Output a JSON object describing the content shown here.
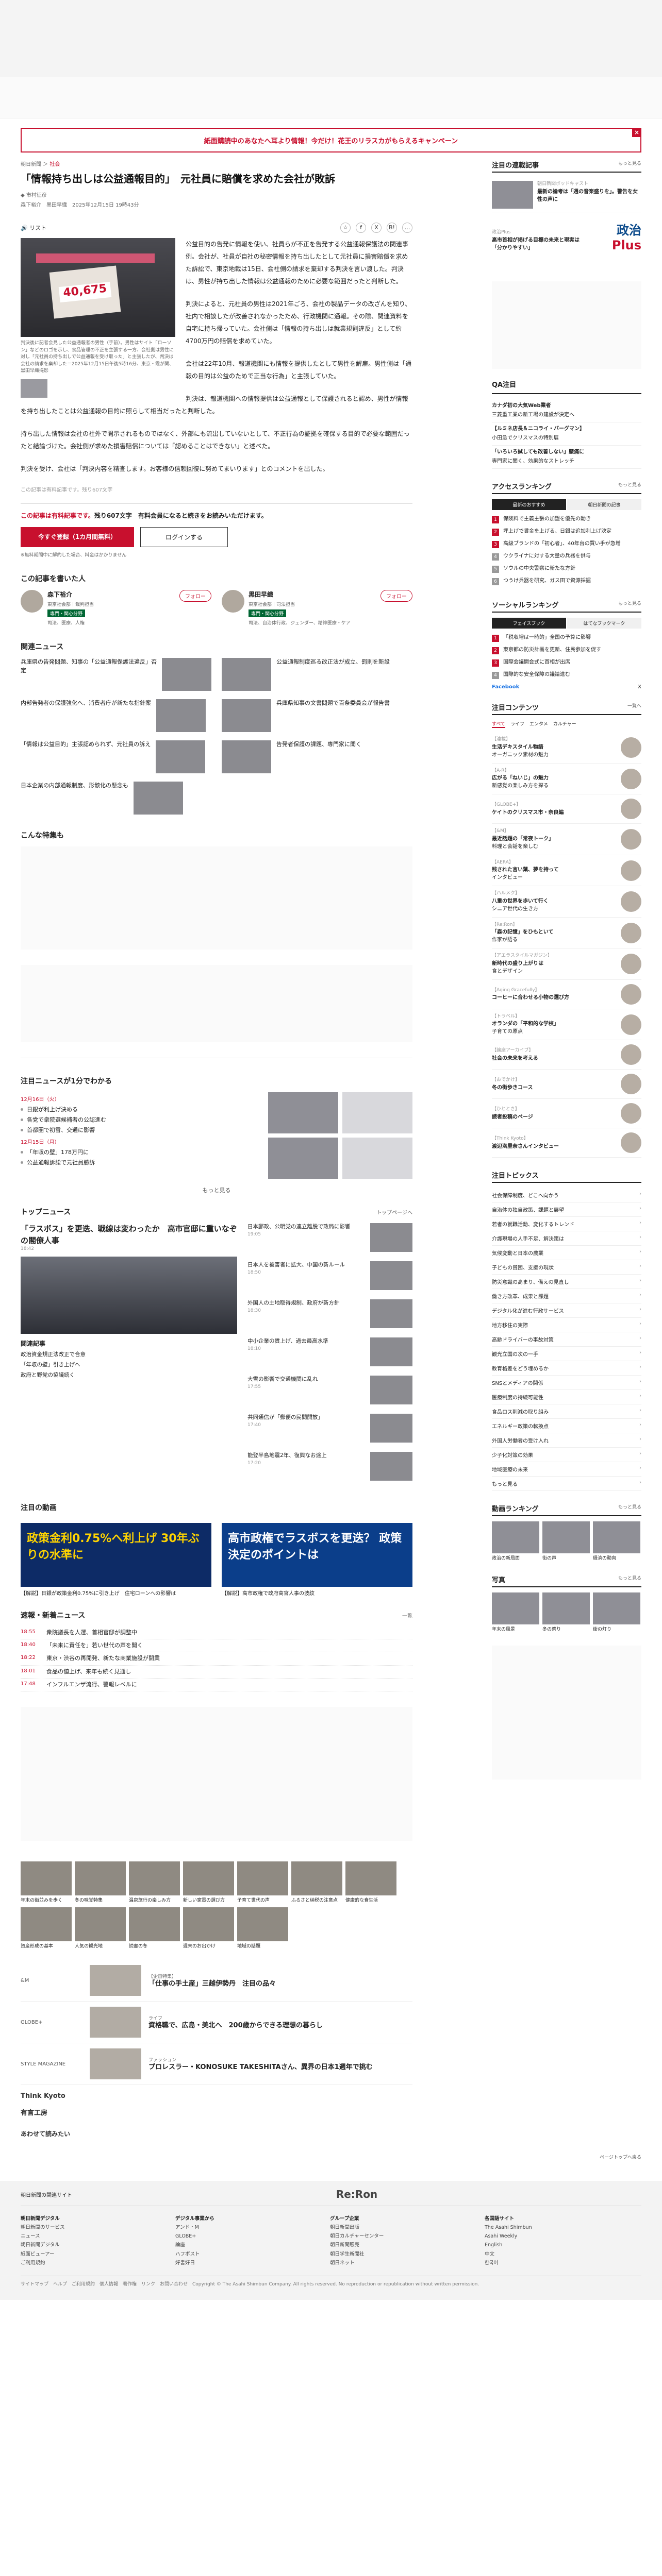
{
  "banner": {
    "text": "紙面購読中のあなたへ耳より情報！今だけ！花王のリラスカがもらえるキャンペーン",
    "close": "×"
  },
  "article": {
    "crumb_section": "朝日新聞",
    "crumb_badge": "社会",
    "title": "「情報持ち出しは公益通報目的」　元社員に賠償を求めた会社が敗訴",
    "author": "市村征彦",
    "meta": "森下裕介　黒田早織　2025年12月15日 19時43分",
    "listen": "リスト",
    "photo_number": "40,675",
    "caption": "判決後に記者会見した公益通報者の男性（手前）。男性はサイト「ローソン」などのロゴを示し、食品管理の不正を主張する一方、会社側は男性に対し「元社員の持ち出しで公益通報を受け取った」と主張したが、判決は会社の請求を棄却した＝2025年12月15日午後5時16分、東京・霞が関、黒田早織撮影",
    "thumb_caption": "写真",
    "paragraphs": [
      "公益目的の告発に情報を使い、社員らが不正を告発する公益通報保護法の関連事例。会社が、社員が自社の秘密情報を持ち出したとして元社員に損害賠償を求めた訴訟で、東京地裁は15日、会社側の請求を棄却する判決を言い渡した。判決は、男性が持ち出した情報は公益通報のために必要な範囲だったと判断した。",
      "判決によると、元社員の男性は2021年ごろ、会社の製品データの改ざんを知り、社内で相談したが改善されなかったため、行政機関に通報。その際、関連資料を自宅に持ち帰っていた。会社側は「情報の持ち出しは就業規則違反」として約4700万円の賠償を求めていた。",
      "会社は22年10月、報道機関にも情報を提供したとして男性を解雇。男性側は「通報の目的は公益のためで正当な行為」と主張していた。",
      "判決は、報道機関への情報提供は公益通報として保護されると認め、男性が情報を持ち出したことは公益通報の目的に照らして相当だったと判断した。",
      "持ち出した情報は会社の社外で開示されるものではなく、外部にも流出していないとして、不正行為の証拠を確保する目的で必要な範囲だったと結論づけた。会社側が求めた損害賠償については「認めることはできない」と述べた。",
      "判決を受け、会社は「判決内容を精査します。お客様の信頼回復に努めてまいります」とのコメントを出した。"
    ],
    "footnote": "この記事は有料記事です。残り607文字",
    "pay_lead": "この記事は有料記事です。",
    "pay_rest": "残り607文字　有料会員になると続きをお読みいただけます。",
    "btn_trial": "今すぐ登録（1カ月間無料）",
    "btn_login": "ログインする",
    "pay_note": "※無料期間中に解約した場合、料金はかかりません",
    "share_label": "シェア"
  },
  "writers": {
    "title": "この記事を書いた人",
    "list": [
      {
        "name": "森下裕介",
        "dept": "東京社会部｜裁判担当",
        "tag": "専門・関心分野",
        "topics": "司法、医療、人権",
        "follow": "フォロー"
      },
      {
        "name": "黒田早織",
        "dept": "東京社会部｜司法担当",
        "tag": "専門・関心分野",
        "topics": "司法、自治体行政、ジェンダー、精神医療・ケア",
        "follow": "フォロー"
      }
    ]
  },
  "related": {
    "title": "関連ニュース",
    "items": [
      {
        "title": "兵庫県の告発問題、知事の「公益通報保護法違反」否定",
        "date": ""
      },
      {
        "title": "公益通報制度巡る改正法が成立、罰則を新設",
        "date": ""
      },
      {
        "title": "内部告発者の保護強化へ、消費者庁が新たな指針案",
        "date": ""
      },
      {
        "title": "兵庫県知事の文書問題で百条委員会が報告書",
        "date": ""
      },
      {
        "title": "「情報は公益目的」主張認められず、元社員の訴え",
        "date": ""
      },
      {
        "title": "告発者保護の課題、専門家に聞く",
        "date": ""
      },
      {
        "title": "日本企業の内部通報制度、形骸化の懸念も",
        "date": ""
      }
    ]
  },
  "empty_section": "こんな特集も",
  "ranking": {
    "title": "注目ニュースが1分でわかる",
    "date1": "12月16日（火）",
    "items1": [
      "日銀が利上げ決める",
      "各党で衆院選候補者の公認進む",
      "首都圏で初雪、交通に影響"
    ],
    "date2": "12月15日（月）",
    "items2": [
      "「年収の壁」178万円に",
      "公益通報訴訟で元社員勝訴"
    ],
    "more": "もっと見る"
  },
  "topnews": {
    "title": "トップニュース",
    "more": "トップページへ",
    "big": "「ラスボス」を更迭、戦線は変わったか　高市官邸に重いなぞの閣僚人事",
    "big_date": "18:42",
    "rows": [
      {
        "title": "日本郵政、公明党の連立離脱で政局に影響",
        "date": "19:05"
      },
      {
        "title": "日本人を被害者に拡大、中国の新ルール",
        "date": "18:50"
      },
      {
        "title": "外国人の土地取得規制、政府が新方針",
        "date": "18:30"
      },
      {
        "title": "中小企業の賃上げ、過去最高水準",
        "date": "18:10"
      },
      {
        "title": "大雪の影響で交通機関に乱れ",
        "date": "17:55"
      },
      {
        "title": "共同通信が「郵便の民間開放」",
        "date": "17:40"
      },
      {
        "title": "能登半島地震2年、復興なお途上",
        "date": "17:20"
      }
    ],
    "rel_title": "関連記事",
    "rel": [
      "政治資金規正法改正で合意",
      "「年収の壁」引き上げへ",
      "政府と野党の協議続く"
    ]
  },
  "highlights": {
    "title": "注目の動画",
    "cards": [
      {
        "img": "政策金利0.75%へ利上げ 30年ぶりの水準に",
        "text": "【解説】日銀が政策金利0.75%に引き上げ　住宅ローンへの影響は"
      },
      {
        "img": "高市政権でラスボスを更迭？ 政策決定のポイントは",
        "text": "【解説】高市政権で政府高官人事の波紋"
      }
    ]
  },
  "latest": {
    "title": "速報・新着ニュース",
    "more": "一覧",
    "items": [
      {
        "tag": "18:55",
        "title": "衆院議長を人選、首相官邸が調整中"
      },
      {
        "tag": "18:40",
        "title": "「未来に責任を」若い世代の声を聞く"
      },
      {
        "tag": "18:22",
        "title": "東京・渋谷の再開発、新たな商業施設が開業"
      },
      {
        "tag": "18:01",
        "title": "食品の値上げ、来年も続く見通し"
      },
      {
        "tag": "17:48",
        "title": "インフルエンザ流行、警報レベルに"
      }
    ]
  },
  "promos": [
    "年末の街並みを歩く",
    "冬の味覚特集",
    "温泉旅行の楽しみ方",
    "新しい家電の選び方",
    "子育て世代の声",
    "ふるさと納税の注意点",
    "健康的な食生活",
    "資産形成の基本",
    "人気の観光地",
    "読書の冬",
    "週末のお出かけ",
    "地域の話題"
  ],
  "partners": [
    {
      "logo": "&M",
      "kicker": "【企画特集】",
      "head": "「仕事の手土産」三越伊勢丹　注目の品々"
    },
    {
      "logo": "GLOBE+",
      "kicker": "ライフ",
      "head": "資格職で、広島・美北へ　200歳からできる理想の暮らし"
    },
    {
      "logo": "STYLE MAGAZINE",
      "kicker": "ファッション",
      "head": "プロレスラー・KONOSUKE TAKESHITAさん、異界の日本1週年で挑む"
    }
  ],
  "brands": [
    "Think Kyoto",
    "有言工房",
    "あわせて読みたい"
  ],
  "side": {
    "video_title": "注目の連載記事",
    "video_more": "もっと見る",
    "feature": [
      {
        "kicker": "朝日新聞ポッドキャスト",
        "head": "最新の論考は「週の音楽盛りを」。警告を女性の声に",
        "img": ""
      },
      {
        "kicker": "政治Plus",
        "head": "高市首相が掲げる目標の未来と現実は「分かりやすい」"
      }
    ],
    "plus_logo": "政治",
    "plus_sub": "Plus",
    "qa_title": "QA注目",
    "qa": [
      {
        "head": "カナダ初の大気Web業者",
        "sub": "三菱重工業の新工場の建設が決定へ"
      },
      {
        "head": "【ルミネ店長＆ニコライ・バーグマン】",
        "sub": "小田急でクリスマスの特別展"
      },
      {
        "head": "「いろいろ試しても改善しない」腰痛に",
        "sub": "専門家に聞く、効果的なストレッチ"
      }
    ],
    "access_title": "アクセスランキング",
    "access_more": "もっと見る",
    "access_tabs": [
      "最新のおすすめ",
      "朝日新聞の記事"
    ],
    "access": [
      "保険料で主義主張の加盟を優先の動き",
      "坪上げで賃金を上げる、日銀は追加利上げ決定",
      "高級ブランドの「初心者」、40年台の買い手が急増",
      "ウクライナに対する大量の兵器を供与",
      "ソウルの中央警察に新たな方針",
      "つうけ兵器を研究、ガス田で資源採掘"
    ],
    "social_title": "ソーシャルランキング",
    "social_more": "もっと見る",
    "social_tabs": [
      "フェイスブック",
      "はてなブックマーク"
    ],
    "social": [
      "「税収増は一時的」全国の予算に影響",
      "東京都の防災計画を更新、住民参加を促す",
      "国際会議開会式に首相が出席",
      "国際的な安全保障の議論進む"
    ],
    "facebook_label": "Facebook",
    "x_label": "X",
    "serial_title": "注目コンテンツ",
    "serial_more": "一覧へ",
    "serial_tabs": [
      "すべて",
      "ライフ",
      "エンタメ",
      "カルチャー"
    ],
    "serial": [
      {
        "kicker": "【連載】",
        "head": "生活デキスタイル物語",
        "sub": "オーガニック素材の魅力"
      },
      {
        "kicker": "【A-R】",
        "head": "広がる「ねいじ」の魅力",
        "sub": "新感覚の楽しみ方を探る"
      },
      {
        "kicker": "【GLOBE+】",
        "head": "ケイトのクリスマス市・奈良編",
        "sub": ""
      },
      {
        "kicker": "【&M】",
        "head": "最近話題の「常夜トーク」",
        "sub": "料理と会話を楽しむ"
      },
      {
        "kicker": "【AERA】",
        "head": "残された言い葉、夢を持って",
        "sub": "インタビュー"
      },
      {
        "kicker": "【ハルメク】",
        "head": "八重の世界を歩いて行く",
        "sub": "シニア世代の生き方"
      },
      {
        "kicker": "【Re:Ron】",
        "head": "「森の記憶」をひもといて",
        "sub": "作家が語る"
      },
      {
        "kicker": "【アエラスタイルマガジン】",
        "head": "新時代の盛り上がりは",
        "sub": "食とデザイン"
      },
      {
        "kicker": "【Aging Gracefully】",
        "head": "コーヒーに合わせる小物の選び方",
        "sub": ""
      },
      {
        "kicker": "【トラベル】",
        "head": "オランダの「平和的な学校」",
        "sub": "子育ての原点"
      },
      {
        "kicker": "【論座アーカイブ】",
        "head": "社会の未来を考える",
        "sub": ""
      },
      {
        "kicker": "【おでかけ】",
        "head": "冬の街歩きコース",
        "sub": ""
      },
      {
        "kicker": "【ひととき】",
        "head": "読者投稿のページ",
        "sub": ""
      },
      {
        "kicker": "【Think Kyoto】",
        "head": "渡辺満里奈さんインタビュー",
        "sub": ""
      }
    ],
    "top_title": "注目トピックス",
    "top": [
      "社会保障制度、どこへ向かう",
      "自治体の独自政策、課題と展望",
      "若者の就職活動、変化するトレンド",
      "介護現場の人手不足、解決策は",
      "気候変動と日本の農業",
      "子どもの貧困、支援の現状",
      "防災意識の高まり、備えの見直し",
      "働き方改革、成果と課題",
      "デジタル化が進む行政サービス",
      "地方移住の実際",
      "高齢ドライバーの事故対策",
      "観光立国の次の一手",
      "教育格差をどう埋めるか",
      "SNSとメディアの関係",
      "医療制度の持続可能性",
      "食品ロス削減の取り組み",
      "エネルギー政策の転換点",
      "外国人労働者の受け入れ",
      "少子化対策の効果",
      "地域医療の未来"
    ],
    "top_more": "もっと見る",
    "video_rank_title": "動画ランキング",
    "video_rank_more": "もっと見る",
    "video_rank": [
      "政治の新局面",
      "街の声",
      "経済の動向"
    ],
    "photo_title": "写真",
    "photo_more": "もっと見る",
    "photos": [
      "年末の風景",
      "冬の祭り",
      "街の灯り"
    ]
  },
  "footer": {
    "pagetop": "ページトップへ戻る",
    "brand": "朝日新聞の関連サイト",
    "logo": "Re:Ron",
    "cols": [
      {
        "head": "朝日新聞デジタル",
        "links": [
          "朝日新聞のサービス",
          "ニュース",
          "朝日新聞デジタル",
          "紙面ビューアー",
          "ご利用規約"
        ]
      },
      {
        "head": "デジタル事業から",
        "links": [
          "アンド・M",
          "GLOBE+",
          "論座",
          "ハフポスト",
          "好書好日"
        ]
      },
      {
        "head": "グループ企業",
        "links": [
          "朝日新聞出版",
          "朝日カルチャーセンター",
          "朝日新聞販売",
          "朝日学生新聞社",
          "朝日ネット"
        ]
      },
      {
        "head": "各国語サイト",
        "links": [
          "The Asahi Shimbun",
          "Asahi Weekly",
          "English",
          "中文",
          "한국어"
        ]
      }
    ],
    "bottom": "サイトマップ　ヘルプ　ご利用規約　個人情報　著作権　リンク　お問い合わせ　Copyright © The Asahi Shimbun Company. All rights reserved. No reproduction or republication without written permission."
  }
}
